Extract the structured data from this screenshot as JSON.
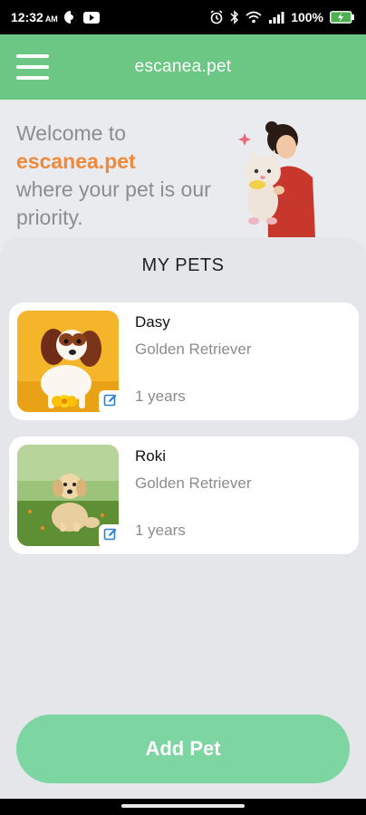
{
  "status_bar": {
    "time": "12:32",
    "time_suffix": "AM",
    "battery": "100%"
  },
  "app_bar": {
    "title": "escanea.pet"
  },
  "welcome": {
    "line1": "Welcome to",
    "brand": "escanea.pet",
    "line2": "where your pet is our priority."
  },
  "pets_section": {
    "title": "MY PETS",
    "pets": [
      {
        "name": "Dasy",
        "breed": "Golden Retriever",
        "age": "1 years"
      },
      {
        "name": "Roki",
        "breed": "Golden Retriever",
        "age": "1 years"
      }
    ]
  },
  "add_pet_label": "Add Pet",
  "colors": {
    "accent_green": "#6cc784",
    "button_green": "#7dd5a2",
    "brand_orange": "#ef8a3d",
    "edit_blue": "#2a7fd4"
  }
}
